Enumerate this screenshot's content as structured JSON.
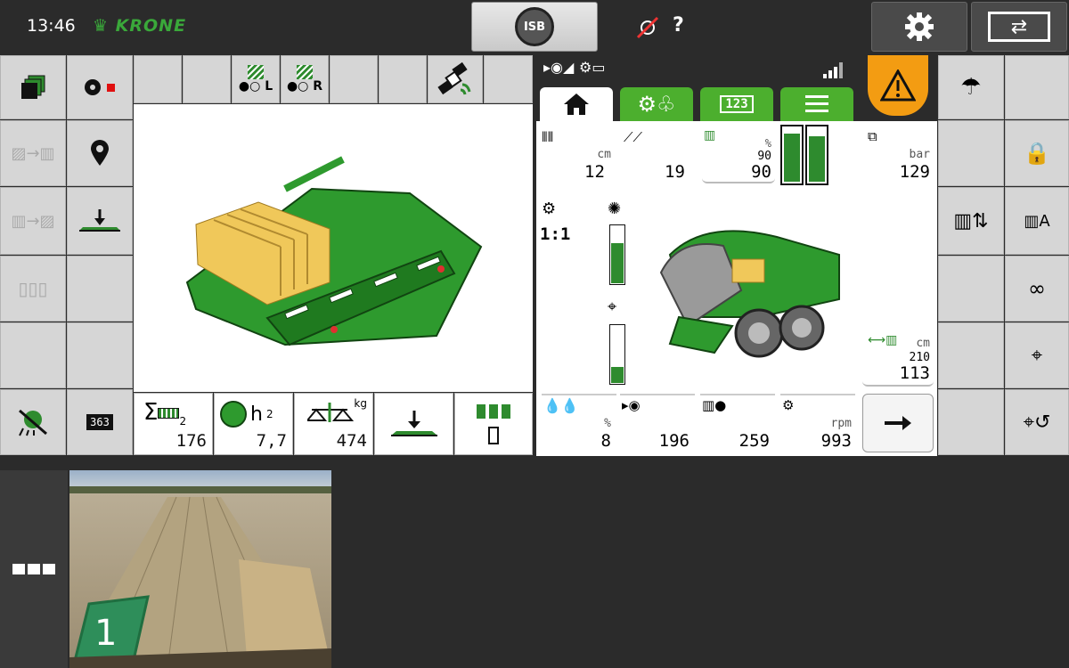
{
  "topbar": {
    "time": "13:46",
    "brand": "KRONE",
    "isb_label": "ISB"
  },
  "left_toolbar": {
    "drive_left_label": "L",
    "drive_right_label": "R"
  },
  "left_stats": [
    {
      "label": "Σ",
      "sub": "2",
      "value": "176"
    },
    {
      "label": "h",
      "sub": "2",
      "value": "7,7"
    },
    {
      "label": "kg",
      "sub": "",
      "value": "474"
    }
  ],
  "right_panel": {
    "tabs": [
      "home",
      "settings",
      "123",
      "menu"
    ],
    "tab_counter_label": "123",
    "bale_length": {
      "unit": "cm",
      "value": "12"
    },
    "knotter_count": {
      "value": "19"
    },
    "fill_level": {
      "unit": "%",
      "small": "90",
      "value": "90"
    },
    "pressure": {
      "unit": "bar",
      "value": "129"
    },
    "ratio": "1:1",
    "bale_target_length": {
      "unit": "cm",
      "small": "210",
      "value": "113"
    },
    "moisture": {
      "unit": "%",
      "value": "8"
    },
    "bales_count": {
      "value": "196"
    },
    "bales_total": {
      "value": "259"
    },
    "pto_speed": {
      "unit": "rpm",
      "value": "993"
    }
  },
  "gauges": {
    "left_fill": 0.9,
    "right_fill": 0.85,
    "vertical_top": 0.7,
    "vertical_bottom": 0.28
  },
  "colors": {
    "krone_green": "#3aa83a",
    "warning_orange": "#f39c12",
    "tab_green": "#4caf2e"
  },
  "camera": {
    "overlay_number": "1"
  }
}
